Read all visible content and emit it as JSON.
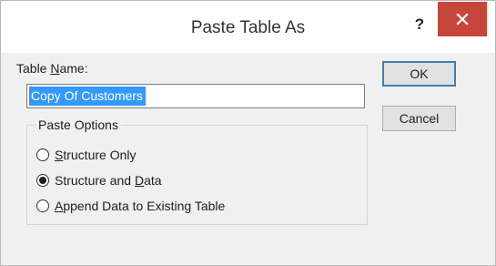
{
  "window": {
    "title": "Paste Table As",
    "help_label": "?",
    "close_icon": "close-icon",
    "colors": {
      "close_button": "#c7463b",
      "selection": "#3399ff",
      "default_button_border": "#3c7fb1"
    }
  },
  "table_name": {
    "label_pre": "Table ",
    "label_accel": "N",
    "label_post": "ame:",
    "value": "Copy Of Customers"
  },
  "paste_options": {
    "legend": "Paste Options",
    "options": [
      {
        "accel": "S",
        "rest": "tructure Only",
        "checked": false
      },
      {
        "pre": "Structure and ",
        "accel": "D",
        "rest": "ata",
        "checked": true
      },
      {
        "accel": "A",
        "rest": "ppend Data to Existing Table",
        "checked": false
      }
    ]
  },
  "buttons": {
    "ok": "OK",
    "cancel": "Cancel"
  }
}
